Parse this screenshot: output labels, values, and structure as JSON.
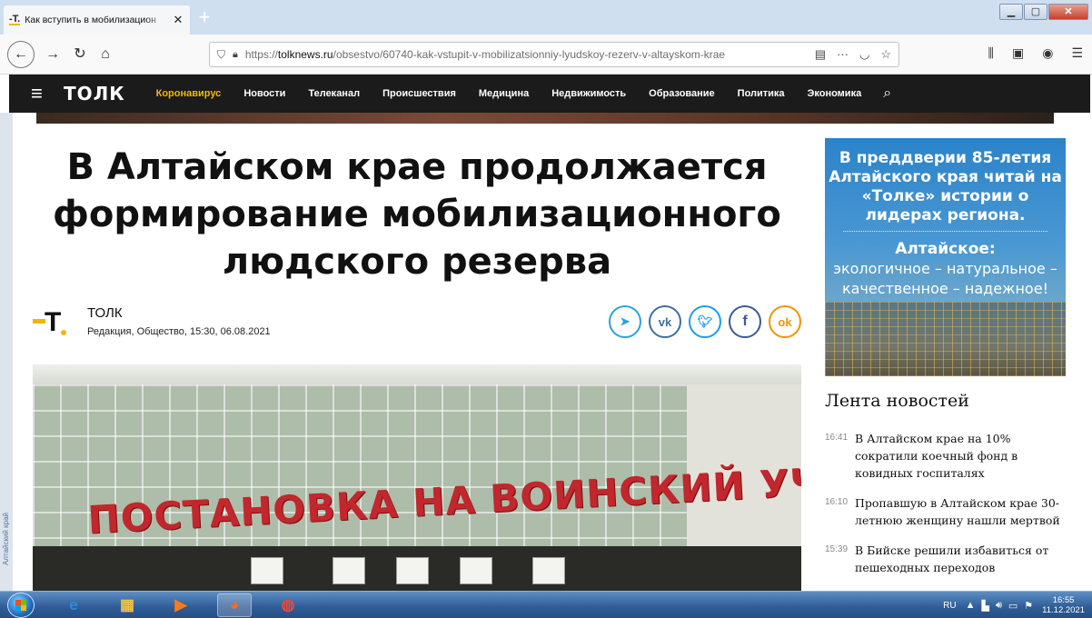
{
  "browser": {
    "tab_title": "Как вступить в мобилизацион",
    "tab_favicon": "-T.",
    "tab_close": "✕",
    "new_tab": "+",
    "url_domain": "tolknews.ru",
    "url_prefix": "https://",
    "url_path": "/obsestvo/60740-kak-vstupit-v-mobilizatsionniy-lyudskoy-rezerv-v-altayskom-krae",
    "icons": [
      "back-icon",
      "forward-icon",
      "reload-icon",
      "home-icon",
      "shield-icon",
      "lock-icon",
      "reader-icon",
      "more-icon",
      "pocket-icon",
      "bookmark-star-icon",
      "library-icon",
      "sidebar-icon",
      "account-icon",
      "menu-icon"
    ]
  },
  "site": {
    "logo": "ТОЛК",
    "menu": [
      {
        "label": "Коронавирус",
        "accent": true
      },
      {
        "label": "Новости"
      },
      {
        "label": "Телеканал"
      },
      {
        "label": "Происшествия"
      },
      {
        "label": "Медицина"
      },
      {
        "label": "Недвижимость"
      },
      {
        "label": "Образование"
      },
      {
        "label": "Политика"
      },
      {
        "label": "Экономика"
      }
    ],
    "left_strip_text": "Алтайский край"
  },
  "article": {
    "headline": "В Алтайском крае продолжается формирование мобилизационного людского резерва",
    "author": "ТОЛК",
    "meta": "Редакция, Общество, 15:30, 06.08.2021",
    "share": [
      "telegram-icon",
      "vk-icon",
      "twitter-icon",
      "facebook-icon",
      "odnoklassniki-icon"
    ],
    "photo_sign": "ПОСТАНОВКА НА ВОИНСКИЙ УЧЁТ"
  },
  "sidebar": {
    "banner_line1": "В преддверии 85-летия Алтайского края читай на «Толке» истории о лидерах региона.",
    "banner_line2": "Алтайское:",
    "banner_line3": "экологичное – натуральное – качественное – надежное!",
    "feed_title": "Лента новостей",
    "feed": [
      {
        "time": "16:41",
        "text": "В Алтайском крае на 10% сократили коечный фонд в ковидных госпиталях"
      },
      {
        "time": "16:10",
        "text": "Пропавшую в Алтайском крае 30-летнюю женщину нашли мертвой"
      },
      {
        "time": "15:39",
        "text": "В Бийске решили избавиться от пешеходных переходов"
      }
    ]
  },
  "taskbar": {
    "lang": "RU",
    "time": "16:55",
    "date": "11.12.2021",
    "apps": [
      "ie-icon",
      "explorer-icon",
      "media-icon",
      "firefox-icon",
      "chrome-icon"
    ]
  }
}
